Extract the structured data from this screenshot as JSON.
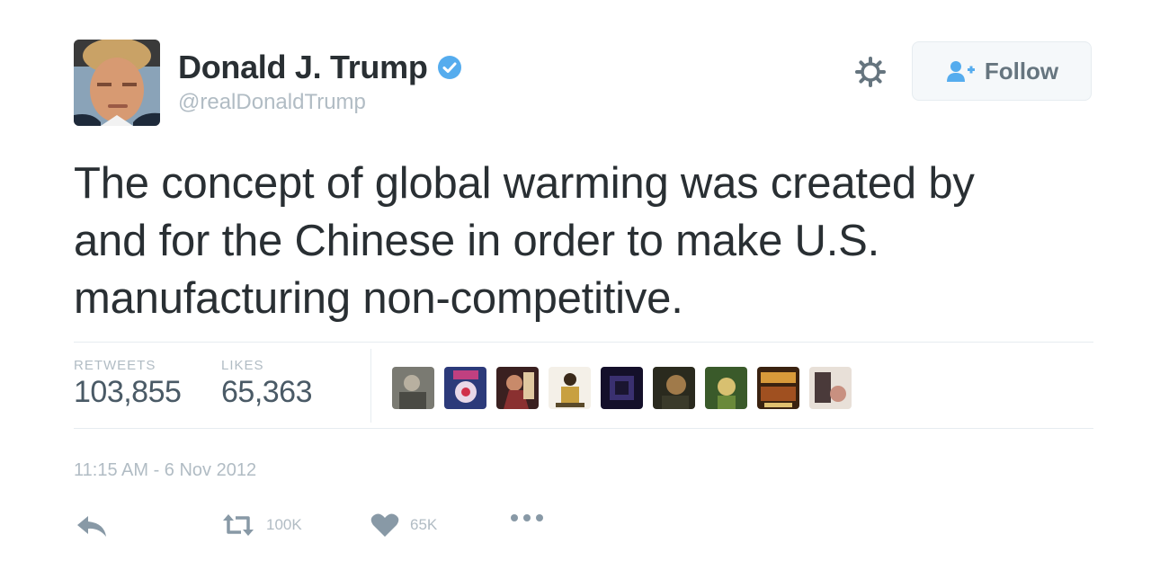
{
  "user": {
    "name": "Donald J. Trump",
    "handle": "@realDonaldTrump",
    "verified": true
  },
  "header": {
    "follow_label": "Follow"
  },
  "tweet": {
    "lines": [
      "The concept of global warming was created by",
      "and for the Chinese in order to make U.S.",
      "manufacturing non-competitive."
    ]
  },
  "stats": {
    "retweets_label": "RETWEETS",
    "retweets_value": "103,855",
    "likes_label": "LIKES",
    "likes_value": "65,363"
  },
  "likers_count_shown": 9,
  "timestamp": "11:15 AM - 6 Nov 2012",
  "actions": {
    "retweet_count": "100K",
    "like_count": "65K"
  },
  "colors": {
    "verified_blue": "#55acee",
    "text_primary": "#292f33",
    "text_muted": "#b1bcc4",
    "follow_blue": "#55acee"
  },
  "icons": [
    "settings-gear-icon",
    "follow-person-icon",
    "verified-badge-icon",
    "reply-icon",
    "retweet-icon",
    "heart-icon",
    "more-dots-icon"
  ]
}
